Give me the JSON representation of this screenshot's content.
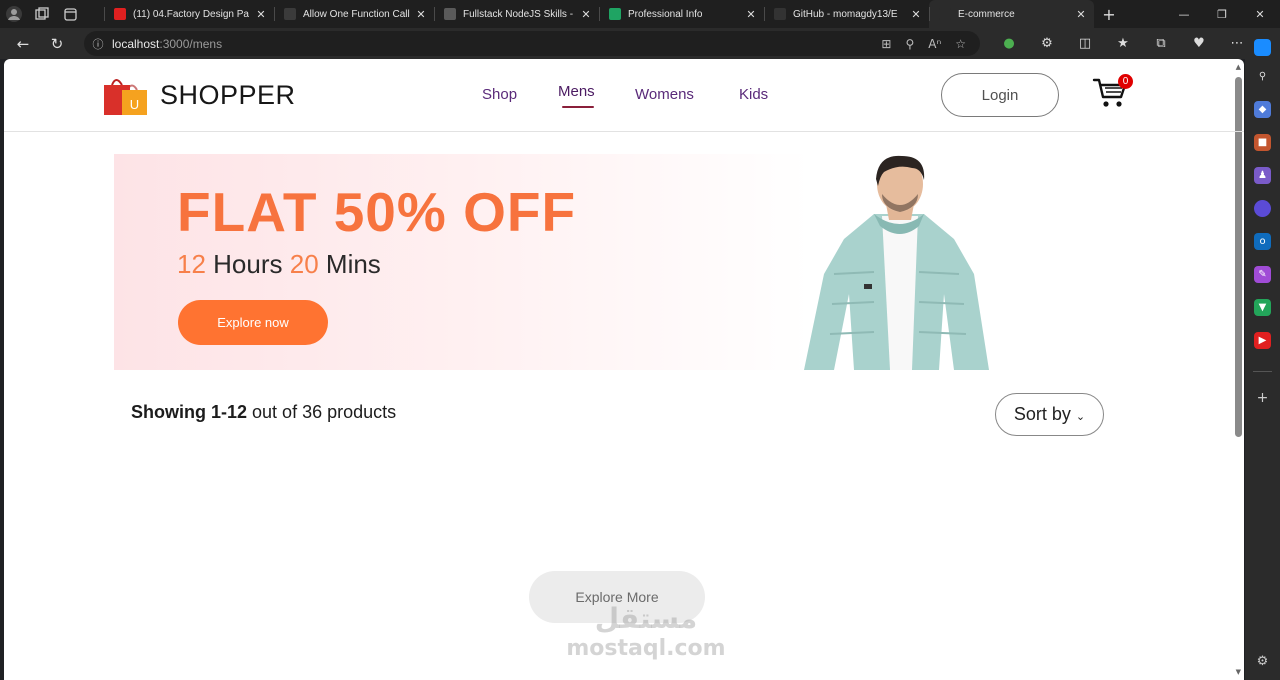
{
  "browser": {
    "tabs": [
      {
        "title": "(11) 04.Factory Design Pa",
        "favicon": "youtube-icon",
        "fav_color": "#e02020"
      },
      {
        "title": "Allow One Function Call",
        "favicon": "dev-icon",
        "fav_color": "#3b3b3b"
      },
      {
        "title": "Fullstack NodeJS Skills - ",
        "favicon": "bot-icon",
        "fav_color": "#5a5a5a"
      },
      {
        "title": "Professional Info",
        "favicon": "f-icon",
        "fav_color": "#1fa463"
      },
      {
        "title": "GitHub - momagdy13/E",
        "favicon": "github-icon",
        "fav_color": "#333333"
      },
      {
        "title": "E-commerce",
        "favicon": "react-icon",
        "fav_color": "#2b2b2b"
      }
    ],
    "url_host": "localhost",
    "url_rest": ":3000/mens"
  },
  "nav": {
    "logo_text": "SHOPPER",
    "logo_letter": "U",
    "menu": [
      "Shop",
      "Mens",
      "Womens",
      "Kids"
    ],
    "login_label": "Login",
    "cart_count": "0"
  },
  "banner": {
    "title": "FLAT 50% OFF",
    "hours_num": "12",
    "hours_label": "Hours",
    "mins_num": "20",
    "mins_label": "Mins",
    "button": "Explore now"
  },
  "products": {
    "showing_bold": "Showing 1-12",
    "showing_rest": "out of 36 products",
    "sort_label": "Sort by"
  },
  "explore_more": "Explore More",
  "watermark": {
    "arabic": "مستقل",
    "latin": "mostaql.com"
  },
  "colors": {
    "accent": "#ff7331",
    "title": "#f7733e",
    "menu": "#5a2a7a",
    "underline": "#8a1f3a",
    "badge": "#e00000"
  }
}
